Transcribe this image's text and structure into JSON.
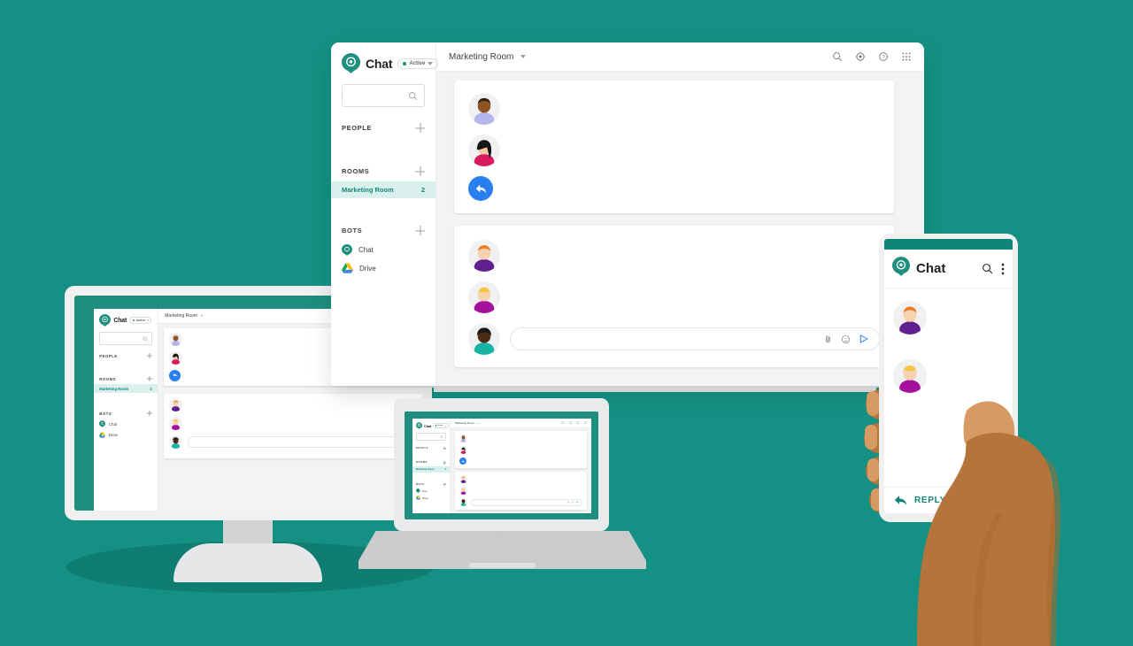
{
  "theme": {
    "background_teal": "#149184",
    "brand_teal": "#1e8e7e",
    "accent_blue": "#2a7ff0",
    "room_highlight_bg": "#d9f0ec",
    "room_highlight_text": "#12897a",
    "skin_tone": "#b5743a"
  },
  "app": {
    "brand_name": "Chat",
    "logo_icon": "chat-at-pin-icon",
    "status_chip": {
      "label": "Active",
      "status_dot": "online-dot-icon",
      "caret_icon": "chevron-down-icon"
    },
    "search": {
      "icon": "search-icon",
      "placeholder": ""
    },
    "sections": [
      {
        "label": "PEOPLE",
        "add_icon": "plus-icon",
        "items": []
      },
      {
        "label": "ROOMS",
        "add_icon": "plus-icon",
        "items": [
          {
            "label": "Marketing Room",
            "badge": "2",
            "selected": true
          }
        ]
      },
      {
        "label": "BOTS",
        "add_icon": "plus-icon",
        "items": [
          {
            "label": "Chat",
            "icon": "chat-bot-icon"
          },
          {
            "label": "Drive",
            "icon": "drive-bot-icon"
          }
        ]
      }
    ],
    "topbar": {
      "room_title": "Marketing Room",
      "room_caret_icon": "chevron-down-icon",
      "icons": [
        "search-icon",
        "gear-icon",
        "help-icon",
        "apps-grid-icon"
      ]
    },
    "cards": [
      {
        "messages": [
          {
            "avatar": "avatar-brown-lavender",
            "line_widths": [
              "62%",
              "40%",
              "28%"
            ]
          },
          {
            "avatar": "avatar-black-crimson",
            "line_widths": [
              "30%",
              "34%"
            ]
          }
        ],
        "reply_button": {
          "icon": "reply-arrow-icon",
          "color": "#2a7ff0"
        }
      },
      {
        "messages": [
          {
            "avatar": "avatar-orange-purple",
            "line_widths": [
              "35%",
              "50%",
              "18%"
            ]
          },
          {
            "avatar": "avatar-blonde-magenta",
            "line_widths": [
              "17%",
              "23%"
            ]
          }
        ],
        "composer": {
          "avatar": "avatar-dark-teal",
          "placeholder": "",
          "icons": [
            "attach-icon",
            "emoji-icon",
            "send-icon"
          ]
        }
      }
    ]
  },
  "phone": {
    "brand_name": "Chat",
    "logo_icon": "chat-at-pin-icon",
    "actions": [
      "search-icon",
      "overflow-menu-icon"
    ],
    "messages": [
      {
        "avatar": "avatar-orange-purple",
        "line_widths": [
          "62%",
          "82%",
          "42%"
        ]
      },
      {
        "avatar": "avatar-blonde-magenta",
        "line_widths": [
          "60%",
          "72%"
        ]
      }
    ],
    "reply": {
      "label": "REPLY",
      "icon": "reply-back-arrow-icon"
    }
  },
  "devices": {
    "monitor": "desktop-monitor",
    "laptop": "laptop-computer",
    "browser_window": "browser-window",
    "phone": "mobile-phone",
    "hand": "hand-holding-phone"
  }
}
